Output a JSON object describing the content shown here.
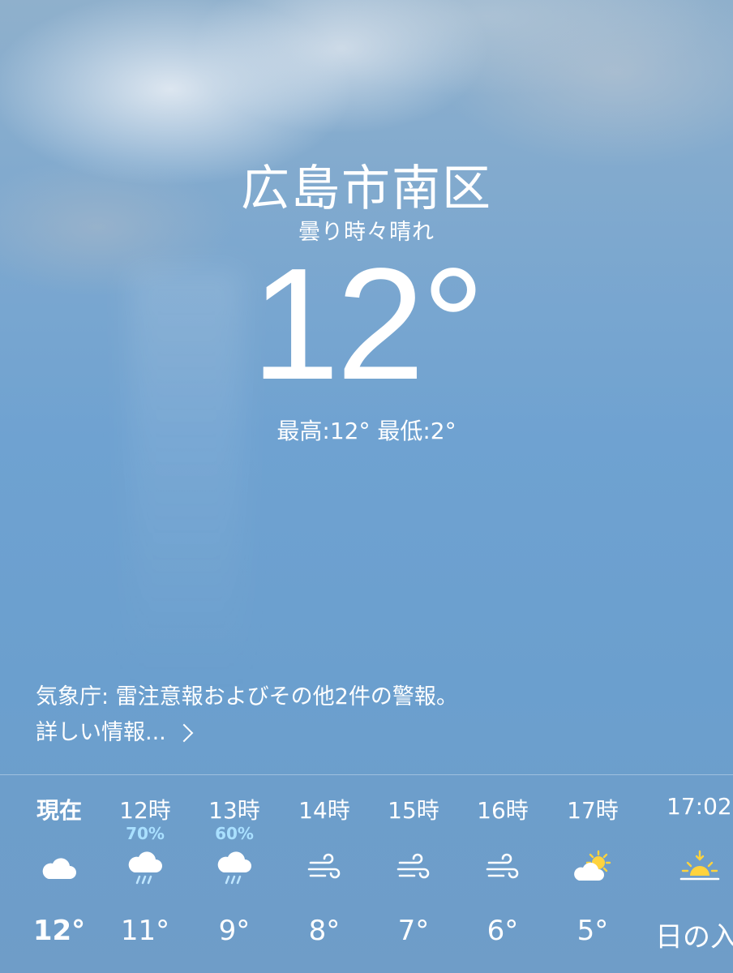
{
  "location": {
    "city": "広島市南区",
    "condition": "曇り時々晴れ"
  },
  "current": {
    "temperature": "12°",
    "high_low": "最高:12° 最低:2°"
  },
  "alert": {
    "text": "気象庁: 雷注意報およびその他2件の警報。",
    "more_label": "詳しい情報..."
  },
  "hourly": [
    {
      "time": "現在",
      "precip": "",
      "icon": "cloud-icon",
      "temp": "12°"
    },
    {
      "time": "12時",
      "precip": "70%",
      "icon": "cloud-rain-icon",
      "temp": "11°"
    },
    {
      "time": "13時",
      "precip": "60%",
      "icon": "cloud-rain-icon",
      "temp": "9°"
    },
    {
      "time": "14時",
      "precip": "",
      "icon": "wind-icon",
      "temp": "8°"
    },
    {
      "time": "15時",
      "precip": "",
      "icon": "wind-icon",
      "temp": "7°"
    },
    {
      "time": "16時",
      "precip": "",
      "icon": "wind-icon",
      "temp": "6°"
    },
    {
      "time": "17時",
      "precip": "",
      "icon": "partly-cloudy-icon",
      "temp": "5°"
    },
    {
      "time": "17:02",
      "precip": "",
      "icon": "sunset-icon",
      "temp": "日の入"
    }
  ],
  "colors": {
    "precip_text": "#a9e0ff",
    "sun": "#ffd33d"
  }
}
